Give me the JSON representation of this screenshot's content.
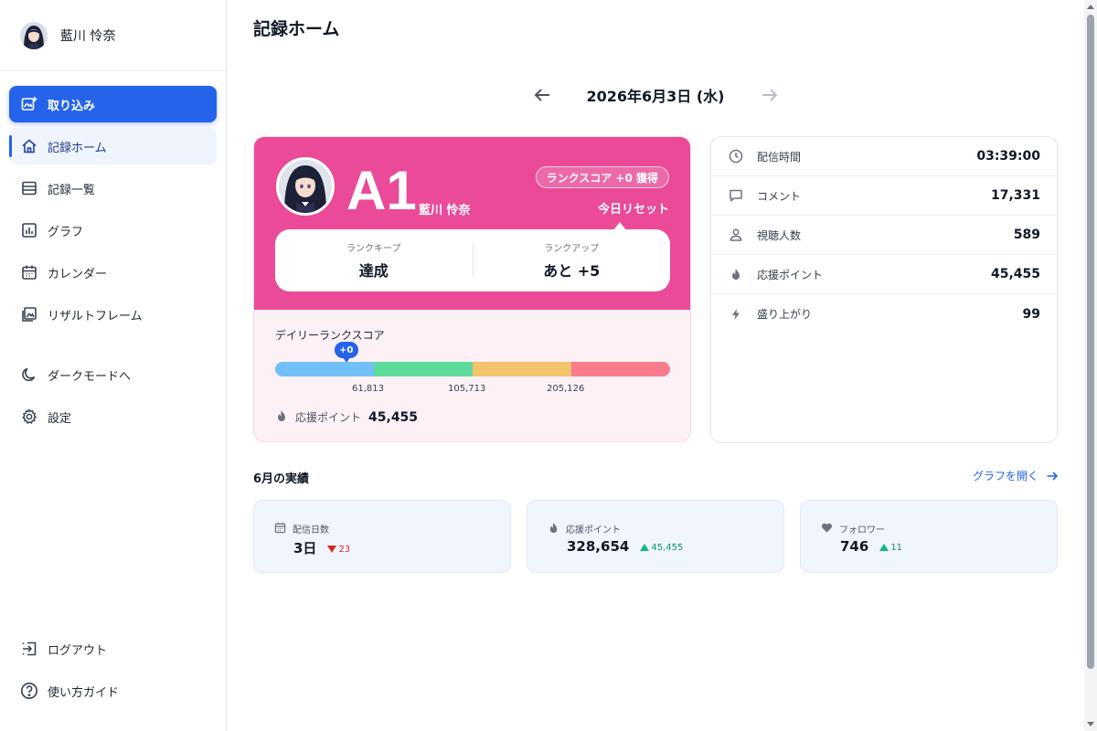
{
  "user": {
    "name": "藍川 怜奈"
  },
  "sidebar": {
    "items": [
      {
        "label": "取り込み",
        "icon": "import-image-icon"
      },
      {
        "label": "記録ホーム",
        "icon": "home-icon"
      },
      {
        "label": "記録一覧",
        "icon": "list-icon"
      },
      {
        "label": "グラフ",
        "icon": "chart-icon"
      },
      {
        "label": "カレンダー",
        "icon": "calendar-icon"
      },
      {
        "label": "リザルトフレーム",
        "icon": "image-frame-icon"
      },
      {
        "label": "ダークモードへ",
        "icon": "moon-icon"
      },
      {
        "label": "設定",
        "icon": "gear-icon"
      },
      {
        "label": "ログアウト",
        "icon": "logout-icon"
      },
      {
        "label": "使い方ガイド",
        "icon": "help-icon"
      }
    ]
  },
  "page": {
    "title": "記録ホーム"
  },
  "date_nav": {
    "date": "2026年6月3日 (水)"
  },
  "rank_card": {
    "grade": "A1",
    "name": "藍川 怜奈",
    "score_badge": "ランクスコア +0 獲得",
    "reset_label": "今日リセット",
    "keep_label": "ランクキープ",
    "keep_value": "達成",
    "up_label": "ランクアップ",
    "up_value": "あと +5",
    "daily_title": "デイリーランクスコア",
    "marker": "+0",
    "marker_fraction": 0.18,
    "ticks": [
      "61,813",
      "105,713",
      "205,126"
    ],
    "ouen_label": "応援ポイント",
    "ouen_value": "45,455",
    "segment_colors": [
      "#73bff7",
      "#5ddb9a",
      "#f4c46c",
      "#f87c8c"
    ],
    "accent": "#ea4a98"
  },
  "stats": [
    {
      "label": "配信時間",
      "value": "03:39:00",
      "icon": "clock-icon"
    },
    {
      "label": "コメント",
      "value": "17,331",
      "icon": "comment-icon"
    },
    {
      "label": "視聴人数",
      "value": "589",
      "icon": "person-icon"
    },
    {
      "label": "応援ポイント",
      "value": "45,455",
      "icon": "flame-icon"
    },
    {
      "label": "盛り上がり",
      "value": "99",
      "icon": "bolt-icon"
    }
  ],
  "monthly": {
    "title": "6月の実績",
    "link": "グラフを開く",
    "cards": [
      {
        "label": "配信日数",
        "value": "3日",
        "delta": "23",
        "direction": "down",
        "icon": "calendar-icon"
      },
      {
        "label": "応援ポイント",
        "value": "328,654",
        "delta": "45,455",
        "direction": "up",
        "icon": "flame-icon"
      },
      {
        "label": "フォロワー",
        "value": "746",
        "delta": "11",
        "direction": "up",
        "icon": "heart-icon"
      }
    ]
  },
  "colors": {
    "primary": "#2563eb",
    "rank_pink": "#ea4a98",
    "down": "#dc2626",
    "up": "#10b981"
  }
}
